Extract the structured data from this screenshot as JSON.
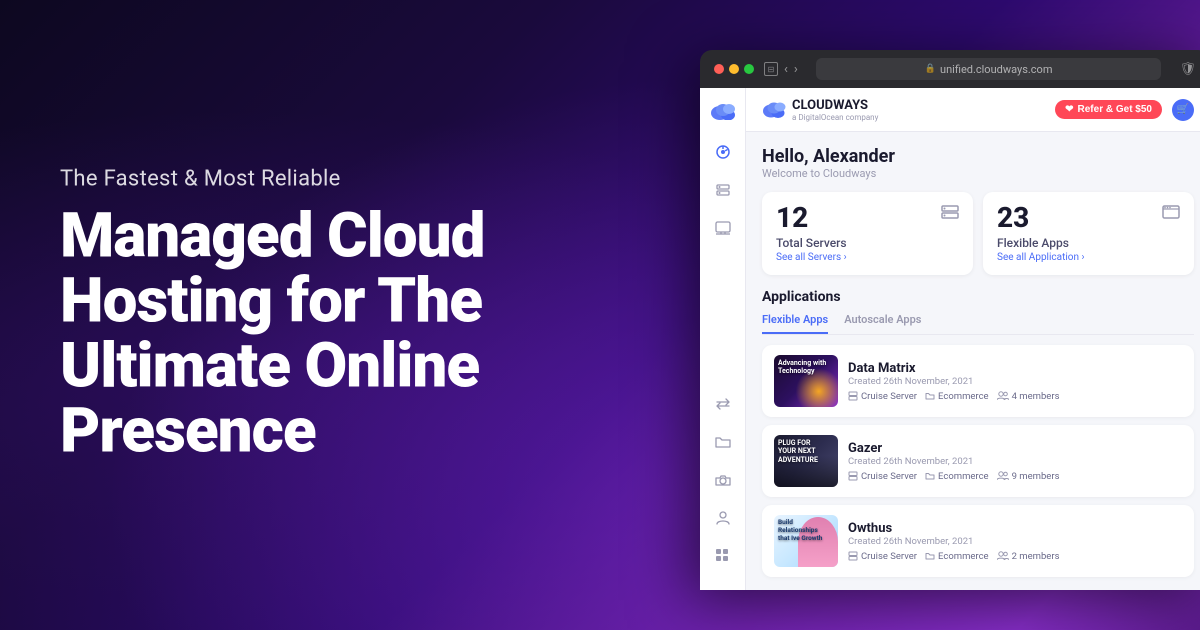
{
  "background": {
    "gradient": "purple-dark"
  },
  "left": {
    "tagline": "The Fastest & Most Reliable",
    "headline_line1": "Managed Cloud",
    "headline_line2": "Hosting for The",
    "headline_line3": "Ultimate Online",
    "headline_line4": "Presence"
  },
  "browser": {
    "url": "unified.cloudways.com",
    "brand_name": "CLOUDWAYS",
    "brand_sub": "a DigitalOcean company",
    "refer_label": "Refer & Get $50"
  },
  "dashboard": {
    "greeting": "Hello, Alexander",
    "greeting_sub": "Welcome to Cloudways",
    "stats": [
      {
        "number": "12",
        "label": "Total Servers",
        "link": "See all Servers ›"
      },
      {
        "number": "23",
        "label": "Flexible Apps",
        "link": "See all Application ›"
      }
    ],
    "section_title": "Applications",
    "tabs": [
      {
        "label": "Flexible Apps",
        "active": true
      },
      {
        "label": "Autoscale Apps",
        "active": false
      }
    ],
    "apps": [
      {
        "name": "Data Matrix",
        "created": "Created 26th November, 2021",
        "server": "Cruise Server",
        "type": "Ecommerce",
        "members": "4 members",
        "thumb_class": "thumb-datamatrix",
        "thumb_text": "Advancing with Technology"
      },
      {
        "name": "Gazer",
        "created": "Created 26th November, 2021",
        "server": "Cruise Server",
        "type": "Ecommerce",
        "members": "9 members",
        "thumb_class": "thumb-gazer",
        "thumb_text": "PLUG FOR YOUR NEXT ADVENTURE"
      },
      {
        "name": "Owthus",
        "created": "Created 26th November, 2021",
        "server": "Cruise Server",
        "type": "Ecommerce",
        "members": "2 members",
        "thumb_class": "thumb-owthus",
        "thumb_text": "Build Relationships that Ive Growth"
      }
    ]
  },
  "sidebar": {
    "icons": [
      {
        "name": "dashboard",
        "symbol": "⊙",
        "active": true
      },
      {
        "name": "servers",
        "symbol": "▦"
      },
      {
        "name": "apps",
        "symbol": "▭"
      },
      {
        "name": "transfer",
        "symbol": "⇌"
      },
      {
        "name": "folder",
        "symbol": "⊟"
      },
      {
        "name": "camera",
        "symbol": "◎"
      },
      {
        "name": "person",
        "symbol": "♟"
      },
      {
        "name": "grid",
        "symbol": "⊞"
      }
    ]
  }
}
